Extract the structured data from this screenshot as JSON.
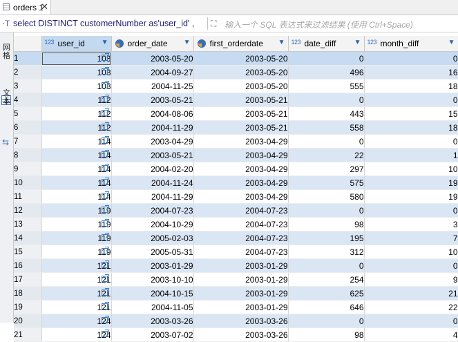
{
  "tab": {
    "label": "orders 1",
    "close": "✕",
    "icon": "table-icon"
  },
  "filter": {
    "sql_icon": "sql-filter-icon",
    "sql_text": "select DISTINCT customerNumber as'user_id' ,",
    "expand_icon": "expand-icon",
    "placeholder": "输入一个 SQL 表达式来过滤结果 (使用 Ctrl+Space)"
  },
  "sidebar": {
    "tab1": "网格",
    "tab2": "文本",
    "panel_icon_label": "⇆"
  },
  "columns": [
    {
      "label": "user_id",
      "type": "123",
      "kind": "number"
    },
    {
      "label": "order_date",
      "type": "date",
      "kind": "date"
    },
    {
      "label": "first_orderdate",
      "type": "date",
      "kind": "date"
    },
    {
      "label": "date_diff",
      "type": "123",
      "kind": "number"
    },
    {
      "label": "month_diff",
      "type": "123",
      "kind": "number"
    }
  ],
  "rows": [
    {
      "n": "1",
      "user_id": "103",
      "order_date": "2003-05-20",
      "first_orderdate": "2003-05-20",
      "date_diff": "0",
      "month_diff": "0"
    },
    {
      "n": "2",
      "user_id": "103",
      "order_date": "2004-09-27",
      "first_orderdate": "2003-05-20",
      "date_diff": "496",
      "month_diff": "16"
    },
    {
      "n": "3",
      "user_id": "103",
      "order_date": "2004-11-25",
      "first_orderdate": "2003-05-20",
      "date_diff": "555",
      "month_diff": "18"
    },
    {
      "n": "4",
      "user_id": "112",
      "order_date": "2003-05-21",
      "first_orderdate": "2003-05-21",
      "date_diff": "0",
      "month_diff": "0"
    },
    {
      "n": "5",
      "user_id": "112",
      "order_date": "2004-08-06",
      "first_orderdate": "2003-05-21",
      "date_diff": "443",
      "month_diff": "15"
    },
    {
      "n": "6",
      "user_id": "112",
      "order_date": "2004-11-29",
      "first_orderdate": "2003-05-21",
      "date_diff": "558",
      "month_diff": "18"
    },
    {
      "n": "7",
      "user_id": "114",
      "order_date": "2003-04-29",
      "first_orderdate": "2003-04-29",
      "date_diff": "0",
      "month_diff": "0"
    },
    {
      "n": "8",
      "user_id": "114",
      "order_date": "2003-05-21",
      "first_orderdate": "2003-04-29",
      "date_diff": "22",
      "month_diff": "1"
    },
    {
      "n": "9",
      "user_id": "114",
      "order_date": "2004-02-20",
      "first_orderdate": "2003-04-29",
      "date_diff": "297",
      "month_diff": "10"
    },
    {
      "n": "10",
      "user_id": "114",
      "order_date": "2004-11-24",
      "first_orderdate": "2003-04-29",
      "date_diff": "575",
      "month_diff": "19"
    },
    {
      "n": "11",
      "user_id": "114",
      "order_date": "2004-11-29",
      "first_orderdate": "2003-04-29",
      "date_diff": "580",
      "month_diff": "19"
    },
    {
      "n": "12",
      "user_id": "119",
      "order_date": "2004-07-23",
      "first_orderdate": "2004-07-23",
      "date_diff": "0",
      "month_diff": "0"
    },
    {
      "n": "13",
      "user_id": "119",
      "order_date": "2004-10-29",
      "first_orderdate": "2004-07-23",
      "date_diff": "98",
      "month_diff": "3"
    },
    {
      "n": "14",
      "user_id": "119",
      "order_date": "2005-02-03",
      "first_orderdate": "2004-07-23",
      "date_diff": "195",
      "month_diff": "7"
    },
    {
      "n": "15",
      "user_id": "119",
      "order_date": "2005-05-31",
      "first_orderdate": "2004-07-23",
      "date_diff": "312",
      "month_diff": "10"
    },
    {
      "n": "16",
      "user_id": "121",
      "order_date": "2003-01-29",
      "first_orderdate": "2003-01-29",
      "date_diff": "0",
      "month_diff": "0"
    },
    {
      "n": "17",
      "user_id": "121",
      "order_date": "2003-10-10",
      "first_orderdate": "2003-01-29",
      "date_diff": "254",
      "month_diff": "9"
    },
    {
      "n": "18",
      "user_id": "121",
      "order_date": "2004-10-15",
      "first_orderdate": "2003-01-29",
      "date_diff": "625",
      "month_diff": "21"
    },
    {
      "n": "19",
      "user_id": "121",
      "order_date": "2004-11-05",
      "first_orderdate": "2003-01-29",
      "date_diff": "646",
      "month_diff": "22"
    },
    {
      "n": "20",
      "user_id": "124",
      "order_date": "2003-03-26",
      "first_orderdate": "2003-03-26",
      "date_diff": "0",
      "month_diff": "0"
    },
    {
      "n": "21",
      "user_id": "124",
      "order_date": "2003-07-02",
      "first_orderdate": "2003-03-26",
      "date_diff": "98",
      "month_diff": "4"
    }
  ],
  "colors": {
    "accent": "#3a6db5",
    "selected_row": "#c6dbf2",
    "alt_row": "#dbe6f4"
  }
}
